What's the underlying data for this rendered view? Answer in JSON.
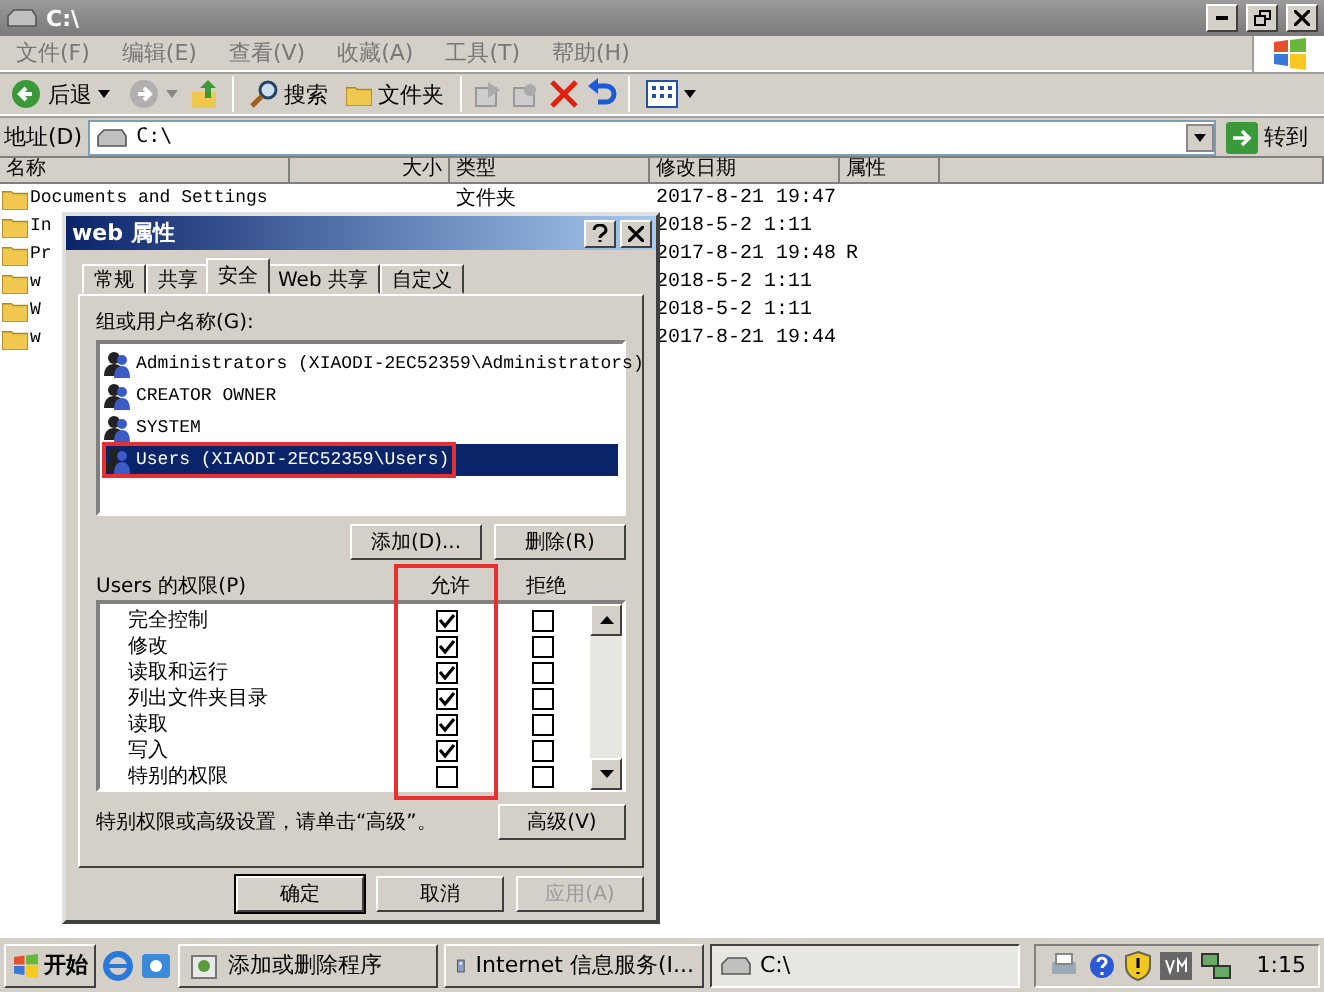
{
  "window": {
    "title": "C:\\"
  },
  "menu": [
    "文件(F)",
    "编辑(E)",
    "查看(V)",
    "收藏(A)",
    "工具(T)",
    "帮助(H)"
  ],
  "toolbar": {
    "back": "后退",
    "search": "搜索",
    "folders": "文件夹"
  },
  "address": {
    "label": "地址(D)",
    "value": "C:\\",
    "go": "转到"
  },
  "table": {
    "columns": [
      "名称",
      "大小",
      "类型",
      "修改日期",
      "属性"
    ],
    "rows": [
      {
        "name": "Documents and Settings",
        "type": "文件夹",
        "date": "2017-8-21 19:47"
      },
      {
        "name": "In",
        "date": "2018-5-2 1:11"
      },
      {
        "name": "Pr",
        "date": "2017-8-21 19:48",
        "attr": "R"
      },
      {
        "name": "w",
        "date": "2018-5-2 1:11"
      },
      {
        "name": "W",
        "date": "2018-5-2 1:11"
      },
      {
        "name": "w",
        "date": "2017-8-21 19:44"
      }
    ]
  },
  "dialog": {
    "title": "web 属性",
    "tabs": [
      {
        "label": "常规",
        "selected": false
      },
      {
        "label": "共享",
        "selected": false
      },
      {
        "label": "安全",
        "selected": true
      },
      {
        "label": "Web 共享",
        "selected": false
      },
      {
        "label": "自定义",
        "selected": false
      }
    ],
    "users_label": "组或用户名称(G):",
    "users": [
      {
        "name": "Administrators (XIAODI-2EC52359\\Administrators)",
        "selected": false,
        "highlighted": false
      },
      {
        "name": "CREATOR OWNER",
        "selected": false,
        "highlighted": false
      },
      {
        "name": "SYSTEM",
        "selected": false,
        "highlighted": false
      },
      {
        "name": "Users (XIAODI-2EC52359\\Users)",
        "selected": true,
        "highlighted": true
      }
    ],
    "user_buttons": [
      "添加(D)...",
      "删除(R)"
    ],
    "permissions_label": "Users 的权限(P)",
    "allow_header": "允许",
    "deny_header": "拒绝",
    "allow_highlighted": true,
    "permissions": [
      {
        "name": "完全控制",
        "allow": true,
        "deny": false
      },
      {
        "name": "修改",
        "allow": true,
        "deny": false
      },
      {
        "name": "读取和运行",
        "allow": true,
        "deny": false
      },
      {
        "name": "列出文件夹目录",
        "allow": true,
        "deny": false
      },
      {
        "name": "读取",
        "allow": true,
        "deny": false
      },
      {
        "name": "写入",
        "allow": true,
        "deny": false
      },
      {
        "name": "特别的权限",
        "allow": false,
        "deny": false
      }
    ],
    "note": "特别权限或高级设置，请单击“高级”。",
    "advanced": "高级(V)",
    "buttons": [
      {
        "label": "确定",
        "disabled": false,
        "default": true
      },
      {
        "label": "取消",
        "disabled": false,
        "default": false
      },
      {
        "label": "应用(A)",
        "disabled": true,
        "default": false
      }
    ]
  },
  "taskbar": {
    "start": "开始",
    "tasks": [
      {
        "label": "添加或删除程序",
        "selected": false,
        "kind": "program"
      },
      {
        "label": "Internet 信息服务(I...",
        "selected": false,
        "kind": "server"
      },
      {
        "label": "C:\\",
        "selected": true,
        "kind": "drive"
      }
    ],
    "clock": "1:15"
  }
}
